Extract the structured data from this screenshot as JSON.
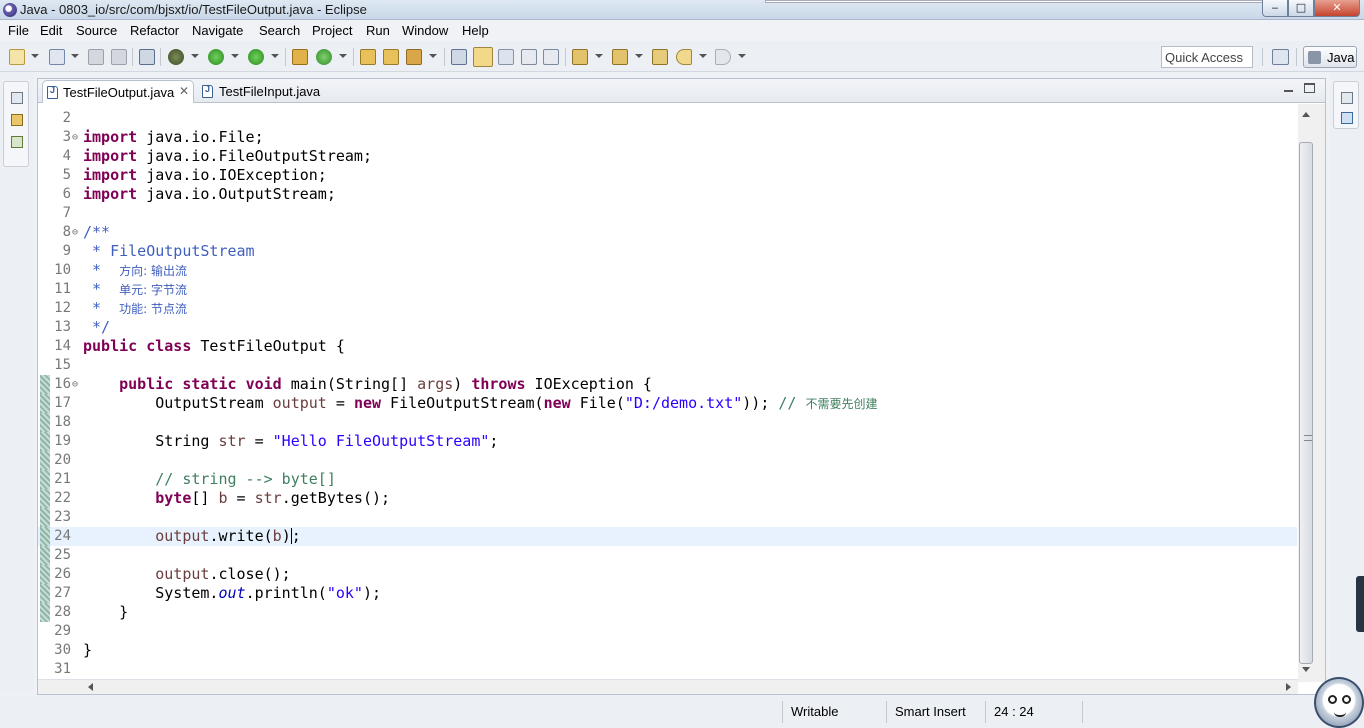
{
  "window": {
    "title": "Java - 0803_io/src/com/bjsxt/io/TestFileOutput.java - Eclipse",
    "min_glyph": "‒",
    "max_glyph": "□",
    "close_glyph": "✕"
  },
  "menu": [
    "File",
    "Edit",
    "Source",
    "Refactor",
    "Navigate",
    "Search",
    "Project",
    "Run",
    "Window",
    "Help"
  ],
  "toolbar": {
    "quick_access": "Quick Access",
    "perspective": "Java"
  },
  "tabs": [
    {
      "label": "TestFileOutput.java",
      "active": true
    },
    {
      "label": "TestFileInput.java",
      "active": false
    }
  ],
  "code": {
    "lines": [
      {
        "n": "2",
        "html": ""
      },
      {
        "n": "3",
        "fold": "⊖",
        "html": "<span class=\"kw\">import</span> java.io.File;"
      },
      {
        "n": "4",
        "html": "<span class=\"kw\">import</span> java.io.FileOutputStream;"
      },
      {
        "n": "5",
        "html": "<span class=\"kw\">import</span> java.io.IOException;"
      },
      {
        "n": "6",
        "html": "<span class=\"kw\">import</span> java.io.OutputStream;"
      },
      {
        "n": "7",
        "html": ""
      },
      {
        "n": "8",
        "fold": "⊖",
        "html": "<span class=\"jd\">/**</span>"
      },
      {
        "n": "9",
        "html": "<span class=\"jd\"> * FileOutputStream</span>"
      },
      {
        "n": "10",
        "html": "<span class=\"jd\"> *  <span class=\"cn\">方向: 输出流</span></span>"
      },
      {
        "n": "11",
        "html": "<span class=\"jd\"> *  <span class=\"cn\">单元: 字节流</span></span>"
      },
      {
        "n": "12",
        "html": "<span class=\"jd\"> *  <span class=\"cn\">功能: 节点流</span></span>"
      },
      {
        "n": "13",
        "html": "<span class=\"jd\"> */</span>"
      },
      {
        "n": "14",
        "html": "<span class=\"kw\">public</span> <span class=\"kw\">class</span> TestFileOutput {"
      },
      {
        "n": "15",
        "html": ""
      },
      {
        "n": "16",
        "fold": "⊖",
        "mark": true,
        "html": "    <span class=\"kw\">public</span> <span class=\"kw\">static</span> <span class=\"kw\">void</span> main(String[] <span class=\"var\">args</span>) <span class=\"kw\">throws</span> IOException {"
      },
      {
        "n": "17",
        "mark": true,
        "html": "        OutputStream <span class=\"var\">output</span> = <span class=\"kw\">new</span> FileOutputStream(<span class=\"kw\">new</span> File(<span class=\"str\">\"D:/demo.txt\"</span>)); <span class=\"cm\">// <span class=\"cn\">不需要先创建</span></span>"
      },
      {
        "n": "18",
        "mark": true,
        "html": ""
      },
      {
        "n": "19",
        "mark": true,
        "html": "        String <span class=\"var\">str</span> = <span class=\"str\">\"Hello FileOutputStream\"</span>;"
      },
      {
        "n": "20",
        "mark": true,
        "html": ""
      },
      {
        "n": "21",
        "mark": true,
        "html": "        <span class=\"cm\">// string --&gt; byte[]</span>"
      },
      {
        "n": "22",
        "mark": true,
        "html": "        <span class=\"kw\">byte</span>[] <span class=\"var\">b</span> = <span class=\"var\">str</span>.getBytes();"
      },
      {
        "n": "23",
        "mark": true,
        "html": ""
      },
      {
        "n": "24",
        "mark": true,
        "current": true,
        "html": "        <span class=\"var\">output</span>.write(<span class=\"var\">b</span>)<span class=\"caret\"></span>;"
      },
      {
        "n": "25",
        "mark": true,
        "html": ""
      },
      {
        "n": "26",
        "mark": true,
        "html": "        <span class=\"var\">output</span>.close();"
      },
      {
        "n": "27",
        "mark": true,
        "html": "        System.<span class=\"fld\"><i>out</i></span>.println(<span class=\"str\">\"ok\"</span>);"
      },
      {
        "n": "28",
        "mark": true,
        "html": "    }"
      },
      {
        "n": "29",
        "html": ""
      },
      {
        "n": "30",
        "html": "}"
      },
      {
        "n": "31",
        "html": ""
      }
    ]
  },
  "status": {
    "writable": "Writable",
    "insert_mode": "Smart Insert",
    "position": "24 : 24"
  }
}
